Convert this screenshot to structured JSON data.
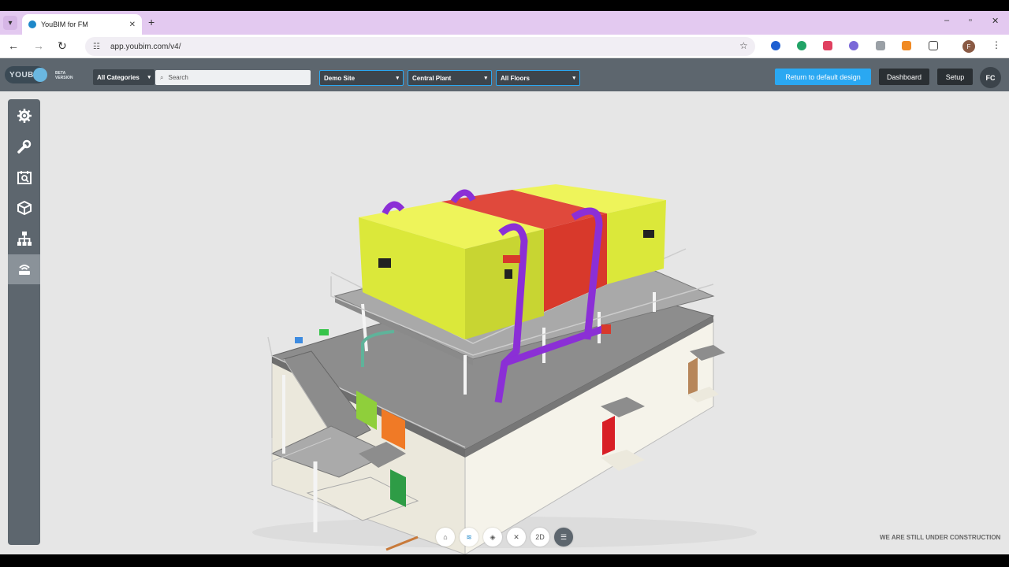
{
  "browser": {
    "tab_title": "YouBIM for FM",
    "url": "app.youbim.com/v4/"
  },
  "app": {
    "logo_text": "YOUBIM",
    "beta_line1": "BETA",
    "beta_line2": "VERSION",
    "category_select": "All Categories",
    "search_placeholder": "Search",
    "site_select": "Demo Site",
    "building_select": "Central Plant",
    "floor_select": "All Floors",
    "return_button": "Return to default design",
    "dashboard_button": "Dashboard",
    "setup_button": "Setup",
    "user_initials": "FC"
  },
  "sidebar": {
    "items": [
      {
        "icon": "gear-icon",
        "active": false
      },
      {
        "icon": "wrench-icon",
        "active": false
      },
      {
        "icon": "calendar-search-icon",
        "active": false
      },
      {
        "icon": "cube-icon",
        "active": false
      },
      {
        "icon": "hierarchy-icon",
        "active": false
      },
      {
        "icon": "sensor-icon",
        "active": true
      }
    ]
  },
  "view_tools": {
    "home_icon": "home-icon",
    "layers_icon": "layers-icon",
    "box_icon": "box-icon",
    "explode_icon": "explode-icon",
    "mode_2d_label": "2D",
    "list_icon": "list-icon"
  },
  "footer_notice": "WE ARE STILL UNDER CONSTRUCTION",
  "colors": {
    "appbar": "#5d666e",
    "accent_blue": "#2aa8f2",
    "tank_yellow": "#dbe83a",
    "tank_red": "#d8392b",
    "pipe_purple": "#8b2fd6"
  }
}
